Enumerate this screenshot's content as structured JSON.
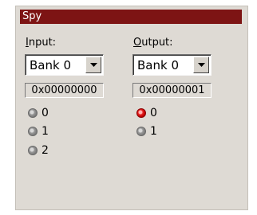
{
  "window": {
    "title": "Spy"
  },
  "input": {
    "label_accel": "I",
    "label_rest": "nput:",
    "bank_selected": "Bank 0",
    "value": "0x00000000",
    "bits": [
      {
        "label": "0",
        "state": "off"
      },
      {
        "label": "1",
        "state": "off"
      },
      {
        "label": "2",
        "state": "off"
      }
    ]
  },
  "output": {
    "label_accel": "O",
    "label_rest": "utput:",
    "bank_selected": "Bank 0",
    "value": "0x00000001",
    "bits": [
      {
        "label": "0",
        "state": "on"
      },
      {
        "label": "1",
        "state": "off"
      }
    ]
  },
  "colors": {
    "title_bg": "#7d1414",
    "panel_bg": "#dedad4",
    "led_on": "#e82020",
    "led_off": "#8c8c8c"
  }
}
